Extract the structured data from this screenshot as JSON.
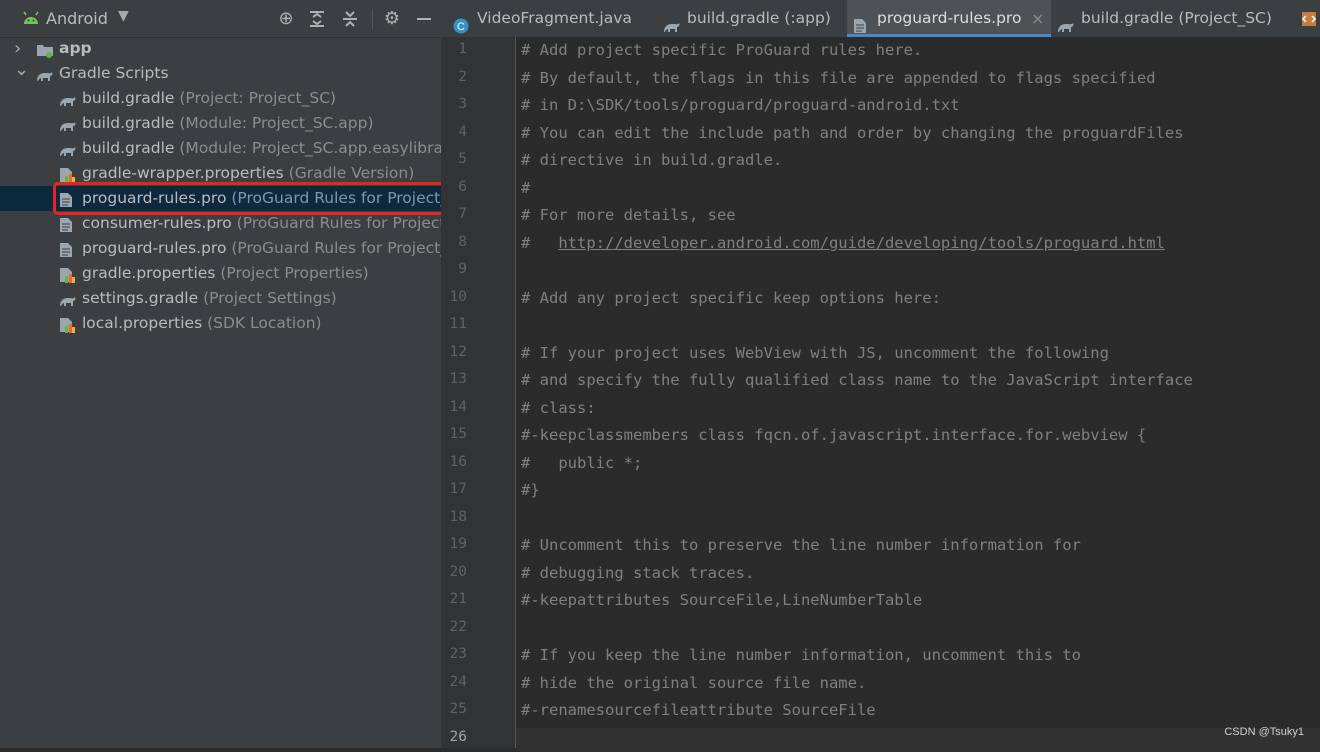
{
  "project_panel": {
    "view_name": "Android",
    "header_icons": [
      "locate-icon",
      "expand-all-icon",
      "collapse-all-icon",
      "gear-icon",
      "minimize-icon"
    ],
    "tree": [
      {
        "kind": "folder",
        "label": "app",
        "hint": "",
        "expanded": false,
        "icon": "module-folder-icon"
      },
      {
        "kind": "folder",
        "label": "Gradle Scripts",
        "hint": "",
        "expanded": true,
        "icon": "gradle-icon"
      },
      {
        "kind": "file",
        "label": "build.gradle",
        "hint": "(Project: Project_SC)",
        "icon": "gradle-icon"
      },
      {
        "kind": "file",
        "label": "build.gradle",
        "hint": "(Module: Project_SC.app)",
        "icon": "gradle-icon"
      },
      {
        "kind": "file",
        "label": "build.gradle",
        "hint": "(Module: Project_SC.app.easylibrary)",
        "icon": "gradle-icon"
      },
      {
        "kind": "file",
        "label": "gradle-wrapper.properties",
        "hint": "(Gradle Version)",
        "icon": "properties-icon"
      },
      {
        "kind": "file",
        "label": "proguard-rules.pro",
        "hint": "(ProGuard Rules for Project_S",
        "icon": "text-file-icon",
        "selected": true
      },
      {
        "kind": "file",
        "label": "consumer-rules.pro",
        "hint": "(ProGuard Rules for Project_S",
        "icon": "text-file-icon"
      },
      {
        "kind": "file",
        "label": "proguard-rules.pro",
        "hint": "(ProGuard Rules for Project_S",
        "icon": "text-file-icon"
      },
      {
        "kind": "file",
        "label": "gradle.properties",
        "hint": "(Project Properties)",
        "icon": "properties-icon"
      },
      {
        "kind": "file",
        "label": "settings.gradle",
        "hint": "(Project Settings)",
        "icon": "gradle-icon"
      },
      {
        "kind": "file",
        "label": "local.properties",
        "hint": "(SDK Location)",
        "icon": "properties-icon"
      }
    ]
  },
  "tabs": [
    {
      "label": "VideoFragment.java",
      "icon": "java-class-icon",
      "active": false
    },
    {
      "label": "build.gradle (:app)",
      "icon": "gradle-icon",
      "active": false
    },
    {
      "label": "proguard-rules.pro",
      "icon": "text-file-icon",
      "active": true,
      "close": "×"
    },
    {
      "label": "build.gradle (Project_SC)",
      "icon": "gradle-icon",
      "active": false
    }
  ],
  "editor": {
    "current_line": 26,
    "lines": [
      "# Add project specific ProGuard rules here.",
      "# By default, the flags in this file are appended to flags specified",
      "# in D:\\SDK/tools/proguard/proguard-android.txt",
      "# You can edit the include path and order by changing the proguardFiles",
      "# directive in build.gradle.",
      "#",
      "# For more details, see",
      "#   http://developer.android.com/guide/developing/tools/proguard.html",
      "",
      "# Add any project specific keep options here:",
      "",
      "# If your project uses WebView with JS, uncomment the following",
      "# and specify the fully qualified class name to the JavaScript interface",
      "# class:",
      "#-keepclassmembers class fqcn.of.javascript.interface.for.webview {",
      "#   public *;",
      "#}",
      "",
      "# Uncomment this to preserve the line number information for",
      "# debugging stack traces.",
      "#-keepattributes SourceFile,LineNumberTable",
      "",
      "# If you keep the line number information, uncomment this to",
      "# hide the original source file name.",
      "#-renamesourcefileattribute SourceFile",
      ""
    ],
    "url_line_prefix": "#   ",
    "url": "http://developer.android.com/guide/developing/tools/proguard.html"
  },
  "watermark": "CSDN @Tsuky1",
  "colors": {
    "selection": "#0d293e",
    "highlight_box": "#e8251b",
    "tab_underline": "#4a88c7",
    "comment": "#808080"
  }
}
